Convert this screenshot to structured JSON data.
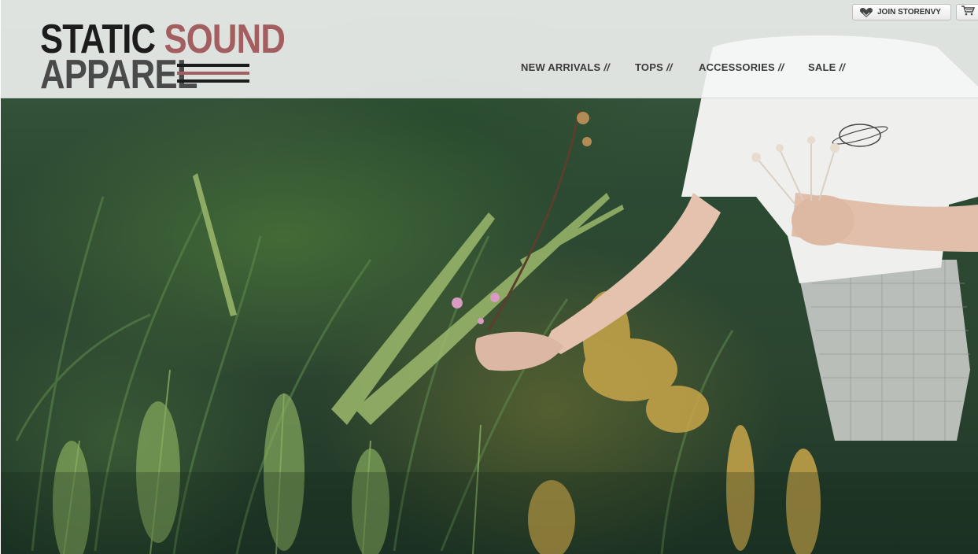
{
  "header": {
    "logo": {
      "word1": "STATIC",
      "word2": "SOUND",
      "word3": "APPAREL",
      "colors": {
        "dark": "#1c1c1c",
        "accent": "#a35e60",
        "gray": "#4a4a4a"
      }
    },
    "nav": [
      {
        "label": "NEW ARRIVALS",
        "sep": "//"
      },
      {
        "label": "TOPS",
        "sep": "//"
      },
      {
        "label": "ACCESSORIES",
        "sep": "//"
      },
      {
        "label": "SALE",
        "sep": "//"
      }
    ],
    "join_button": {
      "label": "JOIN STORENVY",
      "icon": "heart-icon"
    },
    "cart_button": {
      "icon": "cart-icon"
    }
  },
  "hero": {
    "image": "photo of a woman in a white t-shirt holding dried flowers, reaching into tall green ferns and grass"
  }
}
